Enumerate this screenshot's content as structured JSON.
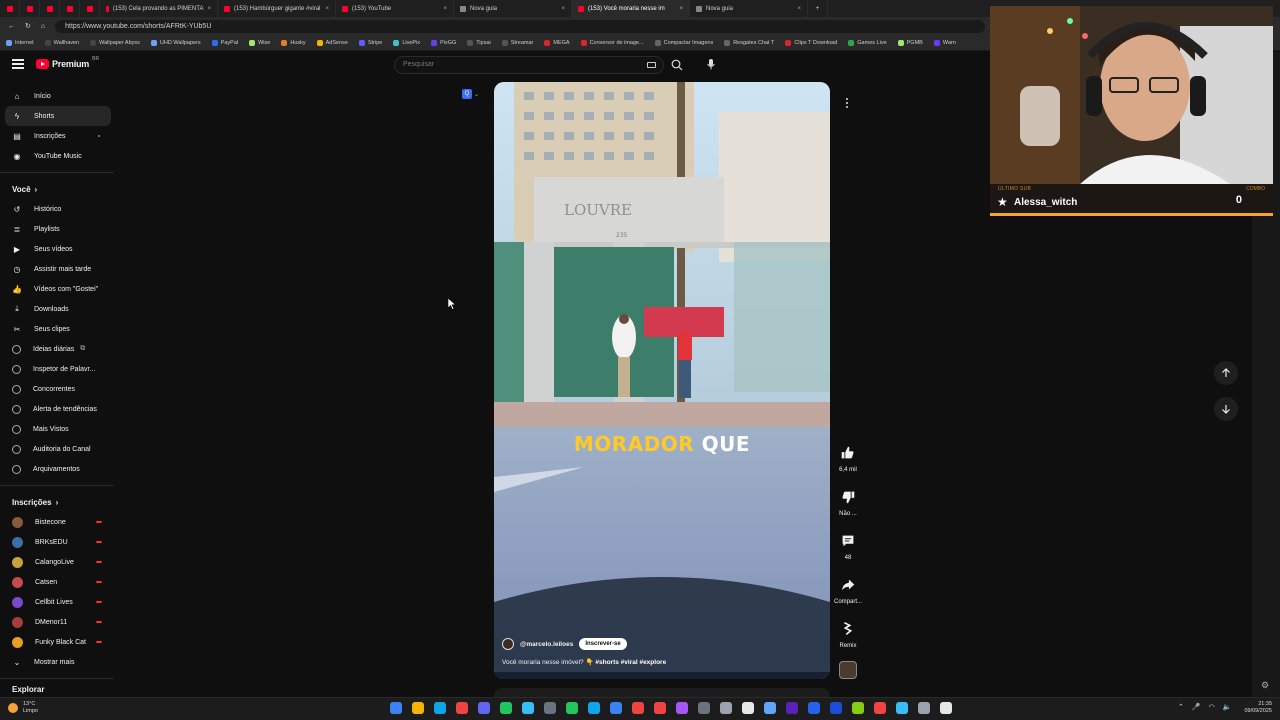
{
  "browser": {
    "tabs": [
      {
        "label": "",
        "mini": true
      },
      {
        "label": "",
        "mini": true
      },
      {
        "label": "",
        "mini": true
      },
      {
        "label": "",
        "mini": true
      },
      {
        "label": "",
        "mini": true
      },
      {
        "label": "(153) Cela provando as PIMENTA",
        "mini": false
      },
      {
        "label": "(153) Hambúrguer gigante #viral",
        "mini": false
      },
      {
        "label": "(153) YouTube",
        "mini": false
      },
      {
        "label": "Nova guia",
        "mini": false
      },
      {
        "label": "(153) Você moraria nesse im",
        "mini": false,
        "active": true
      },
      {
        "label": "Nova guia",
        "mini": false
      }
    ],
    "url": "https://www.youtube.com/shorts/AFRtK-YUb5U",
    "bookmarks": [
      {
        "label": "Internet",
        "color": "#6aa0ff"
      },
      {
        "label": "Wallhaven",
        "color": "#444"
      },
      {
        "label": "Wallpaper Abyss",
        "color": "#444"
      },
      {
        "label": "UHD Wallpapers",
        "color": "#6aa0ff"
      },
      {
        "label": "PayPal",
        "color": "#2a6df4"
      },
      {
        "label": "Wise",
        "color": "#9fe870"
      },
      {
        "label": "Husky",
        "color": "#e67a2e"
      },
      {
        "label": "AdSense",
        "color": "#f4b400"
      },
      {
        "label": "Stripe",
        "color": "#635bff"
      },
      {
        "label": "LivePix",
        "color": "#3ec1d3"
      },
      {
        "label": "PixGG",
        "color": "#6b3cf6"
      },
      {
        "label": "Tipsai",
        "color": "#555"
      },
      {
        "label": "Streamar",
        "color": "#555"
      },
      {
        "label": "MEGA",
        "color": "#d9272e"
      },
      {
        "label": "Conversor de image...",
        "color": "#d9272e"
      },
      {
        "label": "Compactar Imagens",
        "color": "#666"
      },
      {
        "label": "Resgates Chat T",
        "color": "#666"
      },
      {
        "label": "Clips T Download",
        "color": "#d9272e"
      },
      {
        "label": "Games Live",
        "color": "#2aa84a"
      },
      {
        "label": "PGMB",
        "color": "#9fe870"
      },
      {
        "label": "Warn",
        "color": "#6b3cf6"
      }
    ]
  },
  "youtube": {
    "logo_text": "Premium",
    "logo_region": "BR",
    "search_placeholder": "Pesquisar",
    "sidebar": {
      "main": [
        {
          "label": "Início",
          "icon": "home-icon",
          "glyph": "⌂"
        },
        {
          "label": "Shorts",
          "icon": "shorts-icon",
          "glyph": "ϟ",
          "active": true
        },
        {
          "label": "Inscrições",
          "icon": "subscriptions-icon",
          "glyph": "▤"
        },
        {
          "label": "YouTube Music",
          "icon": "music-icon",
          "glyph": "◉"
        }
      ],
      "you_heading": "Você",
      "you": [
        {
          "label": "Histórico",
          "icon": "history-icon",
          "glyph": "↺"
        },
        {
          "label": "Playlists",
          "icon": "playlists-icon",
          "glyph": "≣"
        },
        {
          "label": "Seus vídeos",
          "icon": "your-videos-icon",
          "glyph": "▶"
        },
        {
          "label": "Assistir mais tarde",
          "icon": "watch-later-icon",
          "glyph": "◷"
        },
        {
          "label": "Vídeos com \"Gostei\"",
          "icon": "liked-icon",
          "glyph": "👍"
        },
        {
          "label": "Downloads",
          "icon": "download-icon",
          "glyph": "⤓"
        },
        {
          "label": "Seus clipes",
          "icon": "clips-icon",
          "glyph": "✂"
        },
        {
          "label": "Ideias diárias",
          "icon": "ext-app-icon",
          "glyph": "◎"
        },
        {
          "label": "Inspetor de Palavr...",
          "icon": "ext-app-icon",
          "glyph": "◎"
        },
        {
          "label": "Concorrentes",
          "icon": "ext-app-icon",
          "glyph": "◎"
        },
        {
          "label": "Alerta de tendências",
          "icon": "ext-app-icon",
          "glyph": "◎"
        },
        {
          "label": "Mais Vistos",
          "icon": "ext-app-icon",
          "glyph": "◎"
        },
        {
          "label": "Auditoria do Canal",
          "icon": "ext-app-icon",
          "glyph": "◎"
        },
        {
          "label": "Arquivamentos",
          "icon": "ext-app-icon",
          "glyph": "◎"
        }
      ],
      "subs_heading": "Inscrições",
      "subs": [
        {
          "label": "Bistecone",
          "color": "#8a5a3c"
        },
        {
          "label": "BRKsEDU",
          "color": "#3c6ea8"
        },
        {
          "label": "CalangoLive",
          "color": "#c9a23a"
        },
        {
          "label": "Catsen",
          "color": "#c94a4a"
        },
        {
          "label": "Cellbit Lives",
          "color": "#7a4ac9"
        },
        {
          "label": "DMenor11",
          "color": "#a83c3c"
        },
        {
          "label": "Funky Black Cat",
          "color": "#e6a020"
        }
      ],
      "show_more": "Mostrar mais",
      "explore_heading": "Explorar"
    },
    "short": {
      "caption_yellow": "MORADOR",
      "caption_white": "QUE",
      "channel": "@marcelo.leiloes",
      "subscribe": "Inscrever-se",
      "description": "Você moraria nesse imóvel? 👇",
      "hashtags": "#shorts #viral #explore",
      "sign_text": "LOUVRE",
      "sign_number": "235"
    },
    "actions": [
      {
        "name": "like",
        "label": "6,4 mil",
        "icon": "thumbs-up-icon"
      },
      {
        "name": "dislike",
        "label": "Não ...",
        "icon": "thumbs-down-icon"
      },
      {
        "name": "comments",
        "label": "48",
        "icon": "comment-icon"
      },
      {
        "name": "share",
        "label": "Compart...",
        "icon": "share-icon"
      },
      {
        "name": "remix",
        "label": "Remix",
        "icon": "remix-icon"
      }
    ]
  },
  "overlay": {
    "alert_label": "ÚLTIMO SUB",
    "alert_name": "Alessa_witch",
    "combo_label": "COMBO",
    "combo_value": "0",
    "accent": "#f2a33a"
  },
  "taskbar": {
    "temp": "13°C",
    "weather": "Limpo",
    "time": "21:35",
    "date": "09/09/2025",
    "apps": [
      "#3b82f6",
      "#f4b400",
      "#0ea5e9",
      "#ef4444",
      "#6366f1",
      "#22c55e",
      "#38bdf8",
      "#6b7280",
      "#22c55e",
      "#0ea5e9",
      "#3b82f6",
      "#ef4444",
      "#ef4444",
      "#a855f7",
      "#6b7280",
      "#9ca3af",
      "#e5e7eb",
      "#60a5fa",
      "#5b21b6",
      "#2563eb",
      "#1d4ed8",
      "#84cc16",
      "#ef4444",
      "#38bdf8",
      "#9ca3af",
      "#e5e7eb"
    ]
  }
}
